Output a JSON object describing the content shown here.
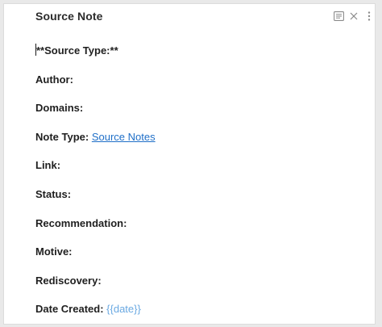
{
  "header": {
    "title": "Source Note",
    "icons": [
      "reading-view-icon",
      "close-icon",
      "more-options-icon"
    ]
  },
  "fields": [
    {
      "label": "**Source Type:**"
    },
    {
      "label": "Author:"
    },
    {
      "label": "Domains:"
    },
    {
      "label": "Note Type:",
      "link": "Source Notes"
    },
    {
      "label": "Link:"
    },
    {
      "label": "Status:"
    },
    {
      "label": "Recommendation:"
    },
    {
      "label": "Motive:"
    },
    {
      "label": "Rediscovery:"
    },
    {
      "label": "Date Created:",
      "template": "{{date}}"
    }
  ],
  "colors": {
    "link": "#1f6fc8",
    "template_var": "#6aa9e2",
    "text": "#1f1f1f",
    "icon": "#8a8a8a"
  }
}
